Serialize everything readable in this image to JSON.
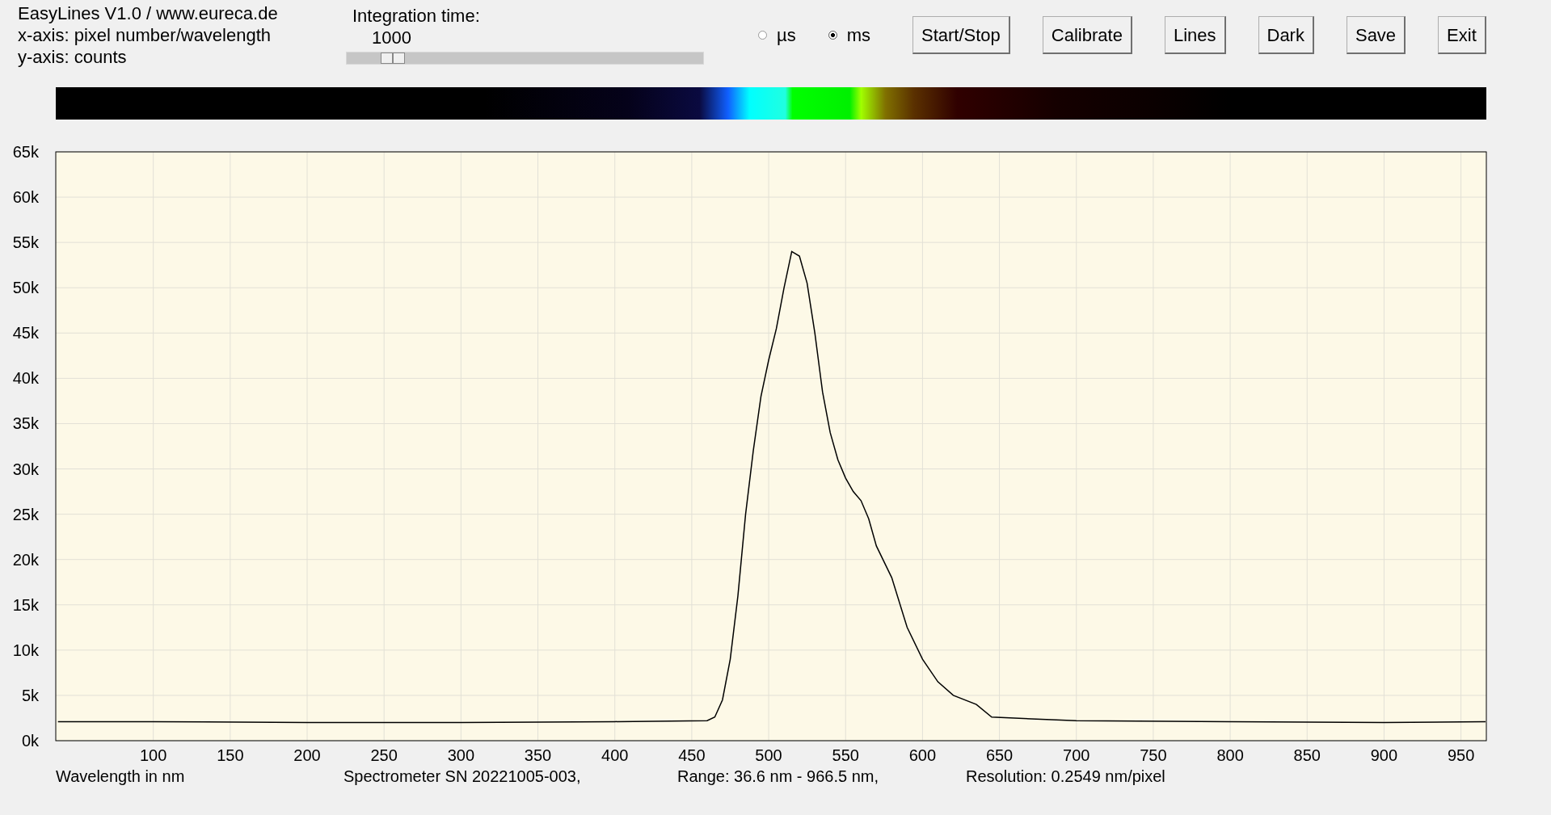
{
  "header": {
    "title": "EasyLines V1.0 / www.eureca.de",
    "x_axis_info": "x-axis: pixel number/wavelength",
    "y_axis_info": "y-axis: counts"
  },
  "integration": {
    "label": "Integration time:",
    "value": "1000",
    "level": 0.13
  },
  "units": [
    {
      "label": "µs",
      "selected": false
    },
    {
      "label": "ms",
      "selected": true
    }
  ],
  "buttons": [
    "Start/Stop",
    "Calibrate",
    "Lines",
    "Dark",
    "Save",
    "Exit"
  ],
  "spectrum": {
    "chart_data": {
      "type": "line",
      "grid": true,
      "xlabel": "Wavelength in nm",
      "xlim": [
        36.6,
        966.5
      ],
      "ylim": [
        0,
        65000
      ],
      "x": [
        38,
        100,
        200,
        300,
        400,
        460,
        465,
        470,
        475,
        480,
        485,
        490,
        495,
        500,
        505,
        510,
        515,
        520,
        525,
        530,
        535,
        540,
        545,
        550,
        555,
        560,
        565,
        570,
        580,
        590,
        600,
        610,
        620,
        635,
        645,
        700,
        800,
        900,
        966
      ],
      "series": [
        {
          "color": "#000000",
          "values": [
            2100,
            2100,
            2000,
            2000,
            2100,
            2200,
            2600,
            4500,
            9000,
            16000,
            25000,
            32000,
            38000,
            42000,
            45500,
            50000,
            54000,
            53500,
            50500,
            45000,
            38500,
            34000,
            31000,
            29000,
            27500,
            26500,
            24500,
            21500,
            18000,
            12500,
            9000,
            6500,
            5000,
            4000,
            2600,
            2200,
            2100,
            2000,
            2100
          ]
        }
      ],
      "xticks": [
        100,
        150,
        200,
        250,
        300,
        350,
        400,
        450,
        500,
        550,
        600,
        650,
        700,
        750,
        800,
        850,
        900,
        950
      ],
      "yticks": [
        {
          "value": 0,
          "label": "0k"
        },
        {
          "value": 5000,
          "label": "5k"
        },
        {
          "value": 10000,
          "label": "10k"
        },
        {
          "value": 15000,
          "label": "15k"
        },
        {
          "value": 20000,
          "label": "20k"
        },
        {
          "value": 25000,
          "label": "25k"
        },
        {
          "value": 30000,
          "label": "30k"
        },
        {
          "value": 35000,
          "label": "35k"
        },
        {
          "value": 40000,
          "label": "40k"
        },
        {
          "value": 45000,
          "label": "45k"
        },
        {
          "value": 50000,
          "label": "50k"
        },
        {
          "value": 55000,
          "label": "55k"
        },
        {
          "value": 60000,
          "label": "60k"
        },
        {
          "value": 65000,
          "label": "65k"
        }
      ]
    }
  },
  "footer": [
    "Spectrometer SN 20221005-003,",
    "Range: 36.6 nm - 966.5 nm,",
    "Resolution: 0.2549 nm/pixel"
  ]
}
